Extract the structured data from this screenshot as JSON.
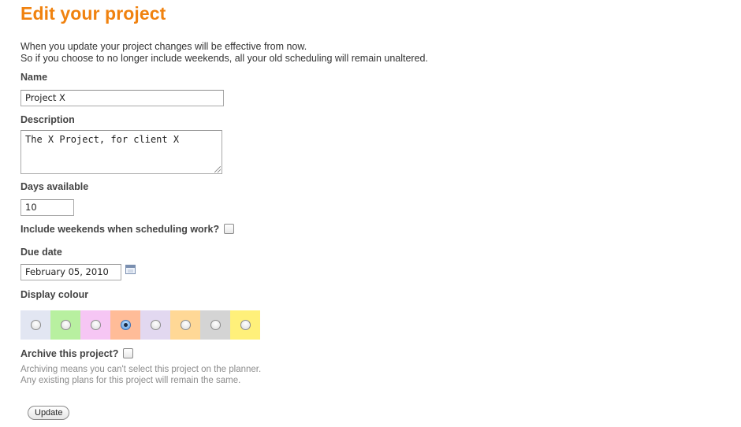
{
  "title": "Edit your project",
  "intro": {
    "line1": "When you update your project changes will be effective from now.",
    "line2": "So if you choose to no longer include weekends, all your old scheduling will remain unaltered."
  },
  "fields": {
    "name": {
      "label": "Name",
      "value": "Project X"
    },
    "description": {
      "label": "Description",
      "value": "The X Project, for client X"
    },
    "days": {
      "label": "Days available",
      "value": "10"
    },
    "weekends": {
      "label": "Include weekends when scheduling work?",
      "checked": false
    },
    "due": {
      "label": "Due date",
      "value": "February 05, 2010"
    },
    "colour": {
      "label": "Display colour",
      "swatches": [
        "#e2e6f2",
        "#b8f0a0",
        "#f6c6f4",
        "#ffbc98",
        "#e2d8f0",
        "#ffd896",
        "#d4d4d4",
        "#fff07a"
      ],
      "selected_index": 3
    },
    "archive": {
      "label": "Archive this project?",
      "checked": false,
      "note1": "Archiving means you can't select this project on the planner.",
      "note2": "Any existing plans for this project will remain the same."
    }
  },
  "submit_label": "Update"
}
